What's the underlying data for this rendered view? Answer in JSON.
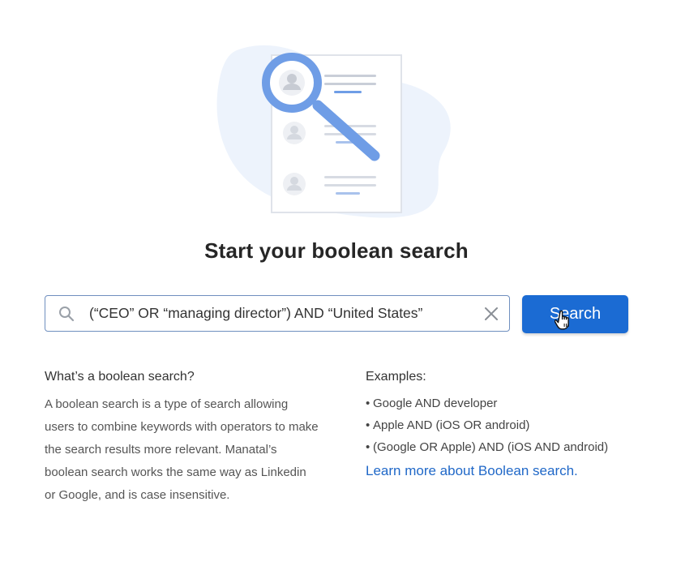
{
  "illustration": {
    "icon": "magnifier-over-profiles-illustration"
  },
  "title": "Start your boolean search",
  "search": {
    "value": "(“CEO” OR “managing director”) AND “United States”",
    "icon": "search-icon",
    "clear_icon": "close-icon",
    "button_label": "Search"
  },
  "info": {
    "heading": "What’s a boolean search?",
    "text": "A boolean search is a type of search allowing users to combine keywords with operators to make the search results more relevant. Manatal’s boolean search works the same way as Linkedin or Google, and is case insensitive."
  },
  "examples": {
    "heading": "Examples:",
    "items": [
      "Google AND developer",
      "Apple AND (iOS OR android)",
      "(Google OR Apple) AND (iOS AND android)"
    ],
    "bullet": "•",
    "link_label": "Learn more about Boolean search."
  },
  "colors": {
    "accent": "#1b6bd3",
    "link": "#2068c8",
    "illustration_blue": "#6f9de6",
    "blob": "#edf3fc"
  }
}
